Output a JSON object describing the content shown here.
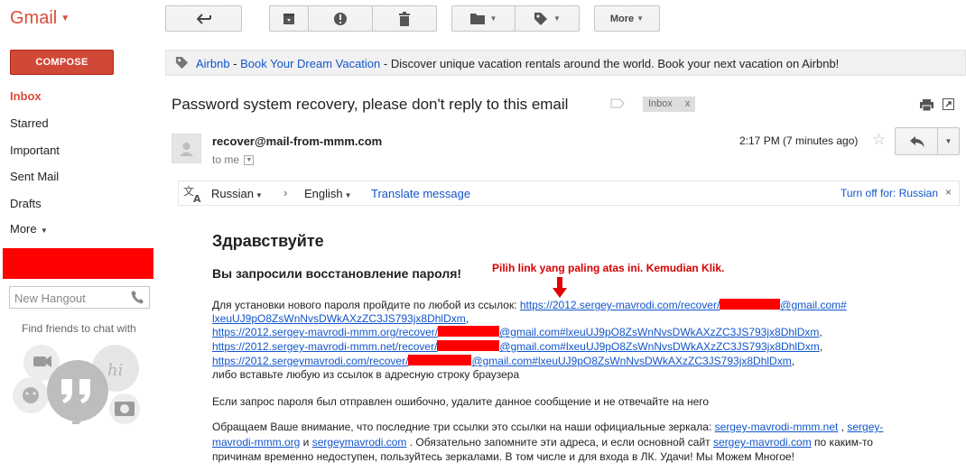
{
  "app": {
    "logo": "Gmail"
  },
  "left_nav": {
    "compose": "COMPOSE",
    "items": [
      "Inbox",
      "Starred",
      "Important",
      "Sent Mail",
      "Drafts",
      "More"
    ],
    "hangout_placeholder": "New Hangout",
    "find_friends": "Find friends to chat with"
  },
  "toolbar": {
    "more_label": "More"
  },
  "ad": {
    "brand": "Airbnb",
    "dash": " - ",
    "title": "Book Your Dream Vacation",
    "text": " - Discover unique vacation rentals around the world. Book your next vacation on Airbnb!"
  },
  "email": {
    "subject": "Password system recovery, please don't reply to this email",
    "label": "Inbox",
    "label_close": "x",
    "sender": "recover@mail-from-mmm.com",
    "to": "to me",
    "time": "2:17 PM (7 minutes ago)"
  },
  "translate": {
    "from": "Russian",
    "separator": "›",
    "to": "English",
    "action": "Translate message",
    "turn_off": "Turn off for: Russian",
    "close": "×"
  },
  "body": {
    "greeting": "Здравствуйте",
    "request_line": "Вы запросили восстановление пароля!",
    "annotation": "Pilih link yang paling atas ini. Kemudian Klik.",
    "install_text": "Для установки нового пароля пройдите по любой из ссылок: ",
    "link1_start": "https://2012.sergey-mavrodi.com/recover/",
    "link1_end": "@gmail.com#",
    "link1_cont": "lxeuUJ9pO8ZsWnNvsDWkAXzZC3JS793jx8DhlDxm",
    "comma": ",",
    "link2_start": "https://2012.sergey-mavrodi-mmm.org/recover/",
    "link2_end": "@gmail.com#lxeuUJ9pO8ZsWnNvsDWkAXzZC3JS793jx8DhlDxm",
    "link3_start": "https://2012.sergey-mavrodi-mmm.net/recover/",
    "link3_end": "@gmail.com#lxeuUJ9pO8ZsWnNvsDWkAXzZC3JS793jx8DhlDxm",
    "link4_start": "https://2012.sergeymavrodi.com/recover/",
    "link4_end": "@gmail.com#lxeuUJ9pO8ZsWnNvsDWkAXzZC3JS793jx8DhlDxm",
    "paste_text": "либо вставьте любую из ссылок в адресную строку браузера",
    "mistake_text": "Если запрос пароля был отправлен ошибочно, удалите данное сообщение и не отвечайте на него",
    "attention_text": "Обращаем Ваше внимание, что последние три ссылки это ссылки на наши официальные зеркала: ",
    "mirror1": "sergey-mavrodi-mmm.net",
    "sep_comma": " , ",
    "mirror2a": "sergey-",
    "mirror2b": "mavrodi-mmm.org",
    "and": " и ",
    "mirror3": "sergeymavrodi.com",
    "remember_text": " . Обязательно запомните эти адреса, и если основной сайт ",
    "mirror4": "sergey-mavrodi.com",
    "by_some": " по каким-то",
    "last_line": "причинам временно недоступен, пользуйтесь зеркалами. В том числе и для входа в ЛК. Удачи! Мы Можем Многое!"
  }
}
